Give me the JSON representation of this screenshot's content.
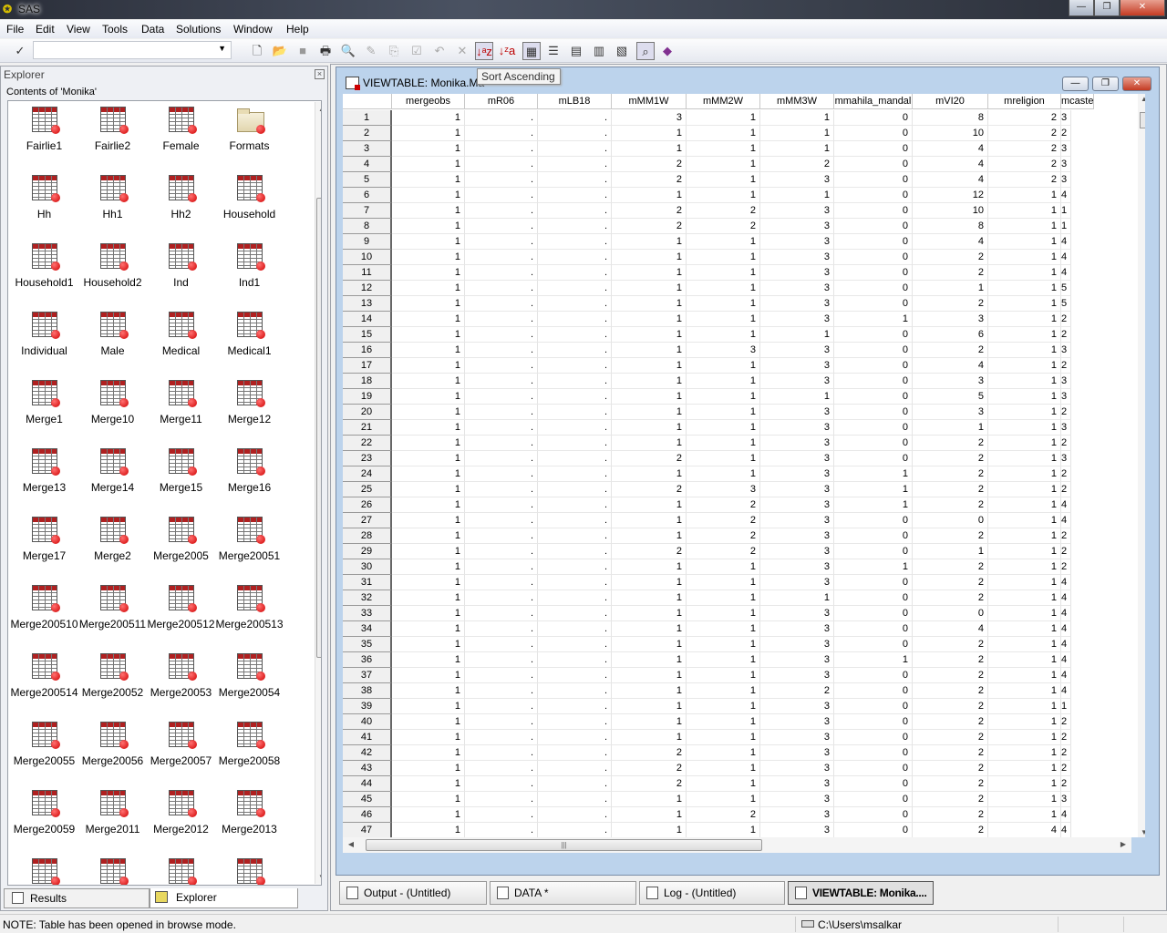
{
  "app": {
    "title": "SAS"
  },
  "menu": [
    "File",
    "Edit",
    "View",
    "Tools",
    "Data",
    "Solutions",
    "Window",
    "Help"
  ],
  "toolbar": {
    "command_value": "",
    "tooltip": "Sort Ascending"
  },
  "explorer": {
    "title": "Explorer",
    "contents_label": "Contents of 'Monika'",
    "items": [
      "Fairlie1",
      "Fairlie2",
      "Female",
      "Formats",
      "Hh",
      "Hh1",
      "Hh2",
      "Household",
      "Household1",
      "Household2",
      "Ind",
      "Ind1",
      "Individual",
      "Male",
      "Medical",
      "Medical1",
      "Merge1",
      "Merge10",
      "Merge11",
      "Merge12",
      "Merge13",
      "Merge14",
      "Merge15",
      "Merge16",
      "Merge17",
      "Merge2",
      "Merge2005",
      "Merge20051",
      "Merge200510",
      "Merge200511",
      "Merge200512",
      "Merge200513",
      "Merge200514",
      "Merge20052",
      "Merge20053",
      "Merge20054",
      "Merge20055",
      "Merge20056",
      "Merge20057",
      "Merge20058",
      "Merge20059",
      "Merge2011",
      "Merge2012",
      "Merge2013",
      "",
      "",
      "",
      ""
    ],
    "folder_items": [
      "Formats"
    ],
    "tabs": [
      "Results",
      "Explorer"
    ]
  },
  "viewtable": {
    "title": "VIEWTABLE: Monika.Ma",
    "columns": [
      "mergeobs",
      "mR06",
      "mLB18",
      "mMM1W",
      "mMM2W",
      "mMM3W",
      "mmahila_mandal",
      "mVI20",
      "mreligion",
      "mcaste"
    ],
    "rows": [
      [
        "1",
        ".",
        ".",
        "3",
        "1",
        "1",
        "0",
        "8",
        "2",
        "3"
      ],
      [
        "1",
        ".",
        ".",
        "1",
        "1",
        "1",
        "0",
        "10",
        "2",
        "2"
      ],
      [
        "1",
        ".",
        ".",
        "1",
        "1",
        "1",
        "0",
        "4",
        "2",
        "3"
      ],
      [
        "1",
        ".",
        ".",
        "2",
        "1",
        "2",
        "0",
        "4",
        "2",
        "3"
      ],
      [
        "1",
        ".",
        ".",
        "2",
        "1",
        "3",
        "0",
        "4",
        "2",
        "3"
      ],
      [
        "1",
        ".",
        ".",
        "1",
        "1",
        "1",
        "0",
        "12",
        "1",
        "4"
      ],
      [
        "1",
        ".",
        ".",
        "2",
        "2",
        "3",
        "0",
        "10",
        "1",
        "1"
      ],
      [
        "1",
        ".",
        ".",
        "2",
        "2",
        "3",
        "0",
        "8",
        "1",
        "1"
      ],
      [
        "1",
        ".",
        ".",
        "1",
        "1",
        "3",
        "0",
        "4",
        "1",
        "4"
      ],
      [
        "1",
        ".",
        ".",
        "1",
        "1",
        "3",
        "0",
        "2",
        "1",
        "4"
      ],
      [
        "1",
        ".",
        ".",
        "1",
        "1",
        "3",
        "0",
        "2",
        "1",
        "4"
      ],
      [
        "1",
        ".",
        ".",
        "1",
        "1",
        "3",
        "0",
        "1",
        "1",
        "5"
      ],
      [
        "1",
        ".",
        ".",
        "1",
        "1",
        "3",
        "0",
        "2",
        "1",
        "5"
      ],
      [
        "1",
        ".",
        ".",
        "1",
        "1",
        "3",
        "1",
        "3",
        "1",
        "2"
      ],
      [
        "1",
        ".",
        ".",
        "1",
        "1",
        "1",
        "0",
        "6",
        "1",
        "2"
      ],
      [
        "1",
        ".",
        ".",
        "1",
        "3",
        "3",
        "0",
        "2",
        "1",
        "3"
      ],
      [
        "1",
        ".",
        ".",
        "1",
        "1",
        "3",
        "0",
        "4",
        "1",
        "2"
      ],
      [
        "1",
        ".",
        ".",
        "1",
        "1",
        "3",
        "0",
        "3",
        "1",
        "3"
      ],
      [
        "1",
        ".",
        ".",
        "1",
        "1",
        "1",
        "0",
        "5",
        "1",
        "3"
      ],
      [
        "1",
        ".",
        ".",
        "1",
        "1",
        "3",
        "0",
        "3",
        "1",
        "2"
      ],
      [
        "1",
        ".",
        ".",
        "1",
        "1",
        "3",
        "0",
        "1",
        "1",
        "3"
      ],
      [
        "1",
        ".",
        ".",
        "1",
        "1",
        "3",
        "0",
        "2",
        "1",
        "2"
      ],
      [
        "1",
        ".",
        ".",
        "2",
        "1",
        "3",
        "0",
        "2",
        "1",
        "3"
      ],
      [
        "1",
        ".",
        ".",
        "1",
        "1",
        "3",
        "1",
        "2",
        "1",
        "2"
      ],
      [
        "1",
        ".",
        ".",
        "2",
        "3",
        "3",
        "1",
        "2",
        "1",
        "2"
      ],
      [
        "1",
        ".",
        ".",
        "1",
        "2",
        "3",
        "1",
        "2",
        "1",
        "4"
      ],
      [
        "1",
        ".",
        ".",
        "1",
        "2",
        "3",
        "0",
        "0",
        "1",
        "4"
      ],
      [
        "1",
        ".",
        ".",
        "1",
        "2",
        "3",
        "0",
        "2",
        "1",
        "2"
      ],
      [
        "1",
        ".",
        ".",
        "2",
        "2",
        "3",
        "0",
        "1",
        "1",
        "2"
      ],
      [
        "1",
        ".",
        ".",
        "1",
        "1",
        "3",
        "1",
        "2",
        "1",
        "2"
      ],
      [
        "1",
        ".",
        ".",
        "1",
        "1",
        "3",
        "0",
        "2",
        "1",
        "4"
      ],
      [
        "1",
        ".",
        ".",
        "1",
        "1",
        "1",
        "0",
        "2",
        "1",
        "4"
      ],
      [
        "1",
        ".",
        ".",
        "1",
        "1",
        "3",
        "0",
        "0",
        "1",
        "4"
      ],
      [
        "1",
        ".",
        ".",
        "1",
        "1",
        "3",
        "0",
        "4",
        "1",
        "4"
      ],
      [
        "1",
        ".",
        ".",
        "1",
        "1",
        "3",
        "0",
        "2",
        "1",
        "4"
      ],
      [
        "1",
        ".",
        ".",
        "1",
        "1",
        "3",
        "1",
        "2",
        "1",
        "4"
      ],
      [
        "1",
        ".",
        ".",
        "1",
        "1",
        "3",
        "0",
        "2",
        "1",
        "4"
      ],
      [
        "1",
        ".",
        ".",
        "1",
        "1",
        "2",
        "0",
        "2",
        "1",
        "4"
      ],
      [
        "1",
        ".",
        ".",
        "1",
        "1",
        "3",
        "0",
        "2",
        "1",
        "1"
      ],
      [
        "1",
        ".",
        ".",
        "1",
        "1",
        "3",
        "0",
        "2",
        "1",
        "2"
      ],
      [
        "1",
        ".",
        ".",
        "1",
        "1",
        "3",
        "0",
        "2",
        "1",
        "2"
      ],
      [
        "1",
        ".",
        ".",
        "2",
        "1",
        "3",
        "0",
        "2",
        "1",
        "2"
      ],
      [
        "1",
        ".",
        ".",
        "2",
        "1",
        "3",
        "0",
        "2",
        "1",
        "2"
      ],
      [
        "1",
        ".",
        ".",
        "2",
        "1",
        "3",
        "0",
        "2",
        "1",
        "2"
      ],
      [
        "1",
        ".",
        ".",
        "1",
        "1",
        "3",
        "0",
        "2",
        "1",
        "3"
      ],
      [
        "1",
        ".",
        ".",
        "1",
        "2",
        "3",
        "0",
        "2",
        "1",
        "4"
      ],
      [
        "1",
        ".",
        ".",
        "1",
        "1",
        "3",
        "0",
        "2",
        "4",
        "4"
      ]
    ]
  },
  "windows": [
    "Output - (Untitled)",
    "DATA *",
    "Log - (Untitled)",
    "VIEWTABLE: Monika...."
  ],
  "status": {
    "note": "NOTE: Table has been opened in browse mode.",
    "path": "C:\\Users\\msalkar"
  }
}
